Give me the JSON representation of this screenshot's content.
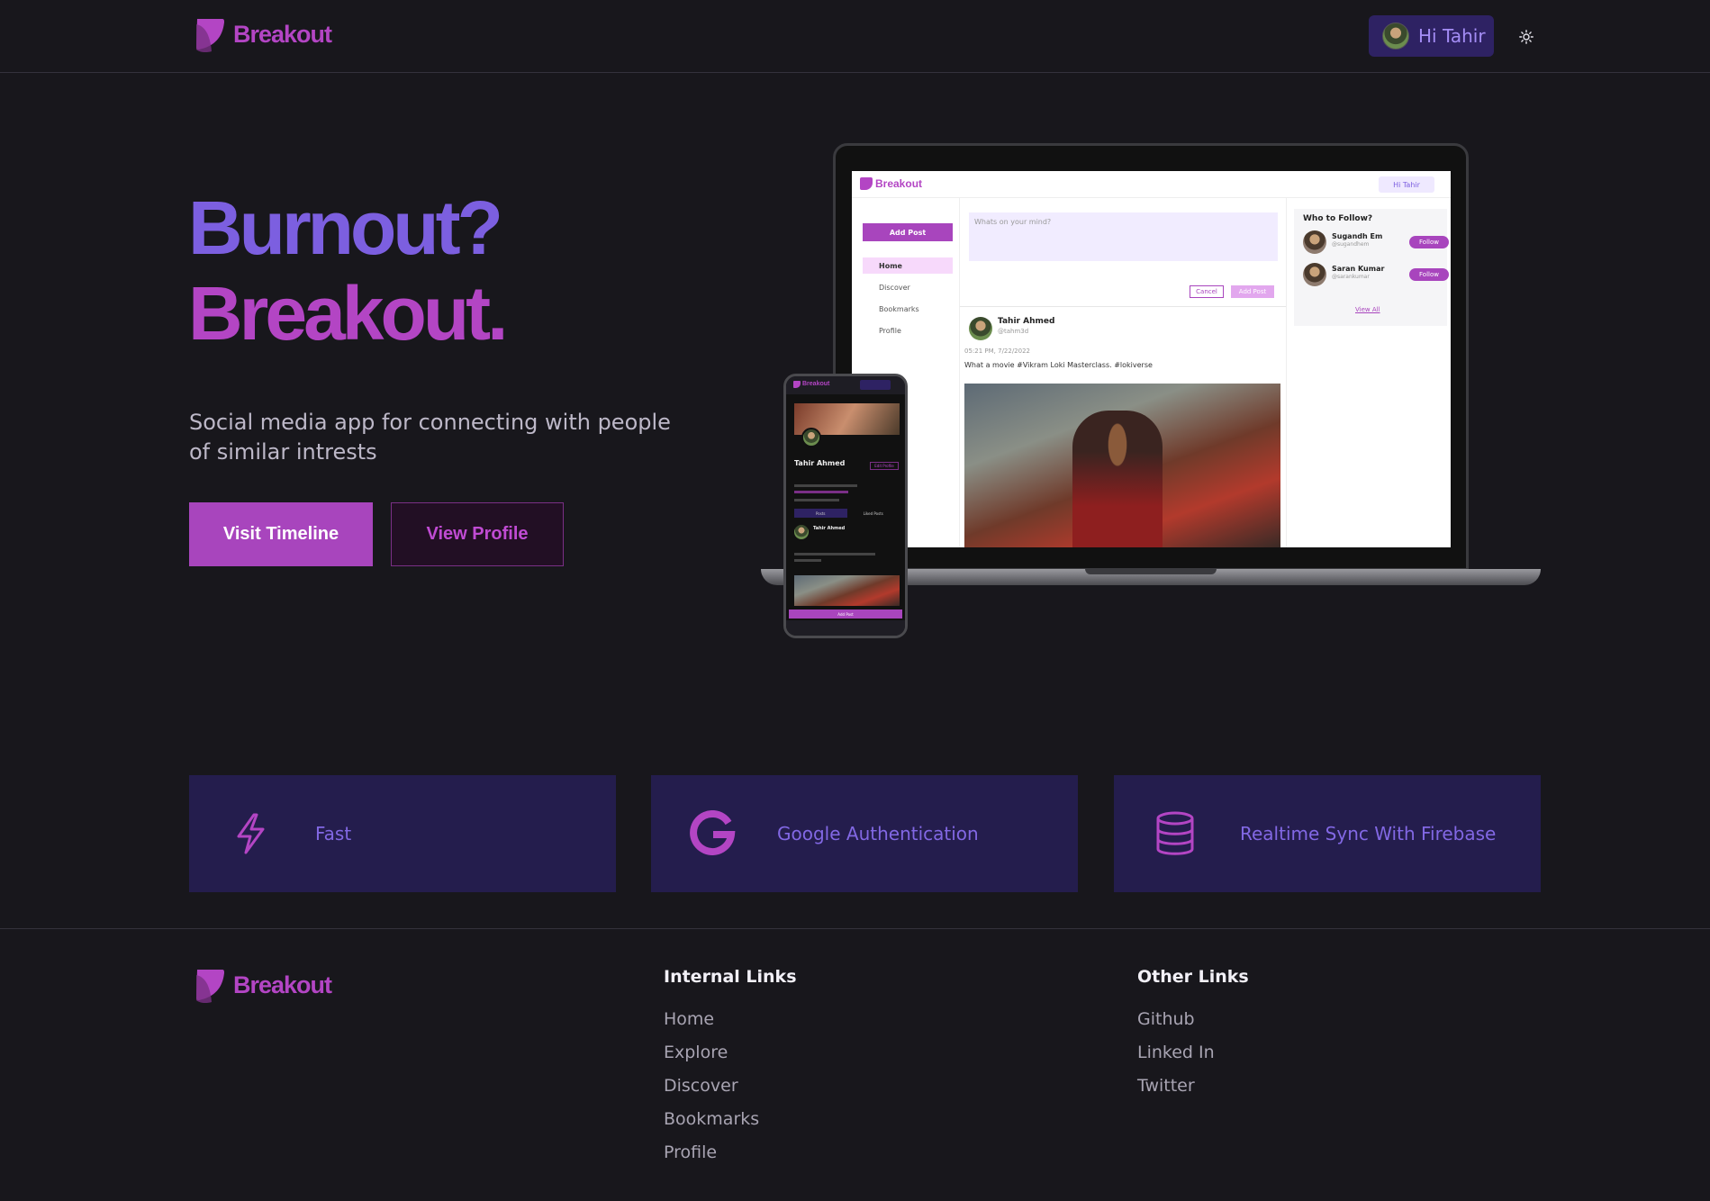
{
  "brand": {
    "name": "Breakout",
    "color": "#b345c4"
  },
  "nav": {
    "greeting": "Hi Tahir",
    "theme_icon": "sun-icon"
  },
  "hero": {
    "line1": "Burnout?",
    "line2": "Breakout.",
    "subtitle": "Social media app for connecting with people of similar intrests",
    "primary_button": "Visit Timeline",
    "secondary_button": "View Profile"
  },
  "mockup": {
    "laptop": {
      "brand": "Breakout",
      "greeting": "Hi Tahir",
      "add_post": "Add Post",
      "nav": [
        "Home",
        "Discover",
        "Bookmarks",
        "Profile"
      ],
      "compose_placeholder": "Whats on your mind?",
      "cancel": "Cancel",
      "add_post_small": "Add Post",
      "post": {
        "name": "Tahir Ahmed",
        "handle": "@tahm3d",
        "time": "05:21 PM, 7/22/2022",
        "text": "What a movie #Vikram Loki Masterclass. #lokiverse"
      },
      "who_to_follow": {
        "title": "Who to Follow?",
        "users": [
          {
            "name": "Sugandh Em",
            "handle": "@sugandhem",
            "action": "Follow"
          },
          {
            "name": "Saran Kumar",
            "handle": "@sarankumar",
            "action": "Follow"
          }
        ],
        "view_all": "View All"
      }
    },
    "phone": {
      "brand": "Breakout",
      "name": "Tahir Ahmed",
      "edit": "Edit Profile",
      "tabs": [
        "Posts",
        "Liked Posts"
      ],
      "post_name": "Tahir Ahmed",
      "add_post": "Add Post"
    }
  },
  "features": [
    {
      "icon": "lightning-icon",
      "label": "Fast"
    },
    {
      "icon": "google-icon",
      "label": "Google Authentication"
    },
    {
      "icon": "database-icon",
      "label": "Realtime Sync With Firebase"
    }
  ],
  "footer": {
    "brand": "Breakout",
    "internal": {
      "title": "Internal Links",
      "links": [
        "Home",
        "Explore",
        "Discover",
        "Bookmarks",
        "Profile"
      ]
    },
    "other": {
      "title": "Other Links",
      "links": [
        "Github",
        "Linked In",
        "Twitter"
      ]
    }
  },
  "colors": {
    "background": "#18171c",
    "accent_purple": "#7c5fe0",
    "accent_magenta": "#b345c4",
    "feature_bg": "#241d4d"
  }
}
